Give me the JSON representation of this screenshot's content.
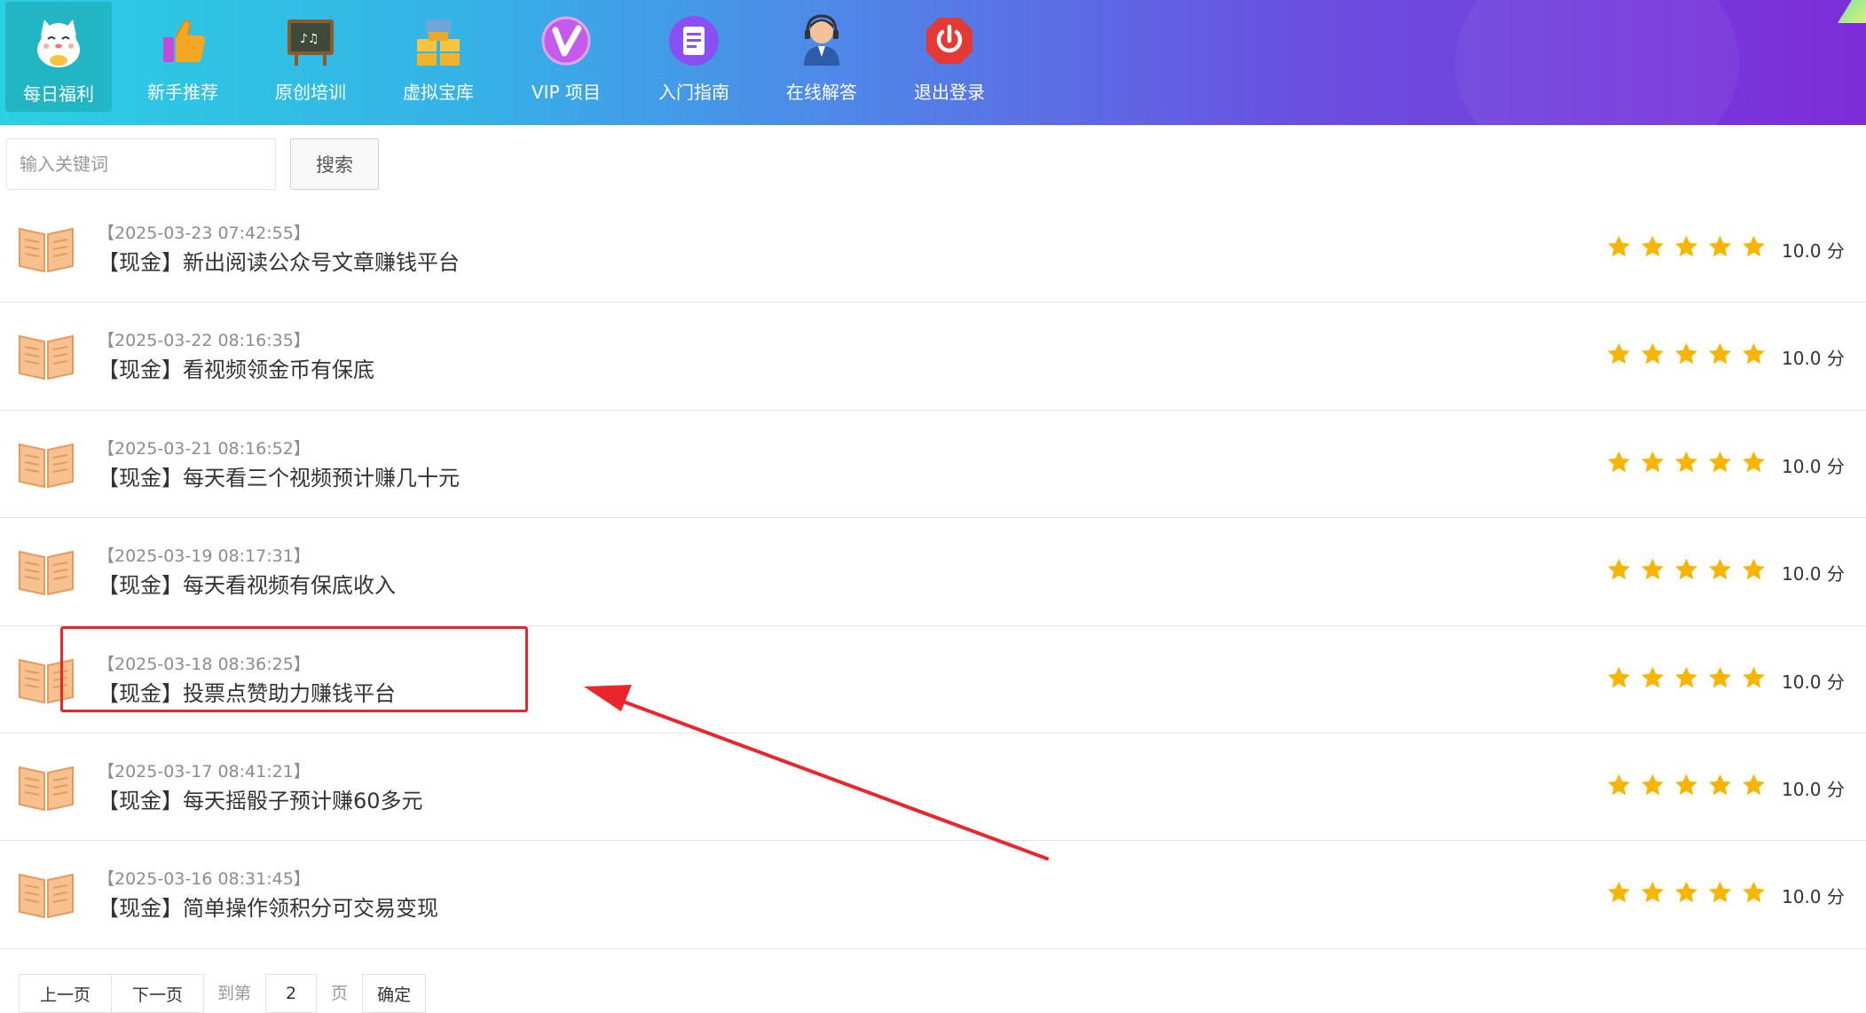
{
  "nav": {
    "items": [
      {
        "label": "每日福利",
        "icon": "lucky-cat-icon",
        "active": true
      },
      {
        "label": "新手推荐",
        "icon": "thumbs-up-icon",
        "active": false
      },
      {
        "label": "原创培训",
        "icon": "blackboard-icon",
        "active": false
      },
      {
        "label": "虚拟宝库",
        "icon": "treasure-boxes-icon",
        "active": false
      },
      {
        "label": "VIP 项目",
        "icon": "vip-badge-icon",
        "active": false
      },
      {
        "label": "入门指南",
        "icon": "document-icon",
        "active": false
      },
      {
        "label": "在线解答",
        "icon": "customer-service-icon",
        "active": false
      },
      {
        "label": "退出登录",
        "icon": "power-icon",
        "active": false
      }
    ]
  },
  "search": {
    "placeholder": "输入关键词",
    "value": "",
    "button_label": "搜索"
  },
  "articles": [
    {
      "date": "【2025-03-23 07:42:55】",
      "title": "【现金】新出阅读公众号文章赚钱平台",
      "rating": 5,
      "score": "10.0 分"
    },
    {
      "date": "【2025-03-22 08:16:35】",
      "title": "【现金】看视频领金币有保底",
      "rating": 5,
      "score": "10.0 分"
    },
    {
      "date": "【2025-03-21 08:16:52】",
      "title": "【现金】每天看三个视频预计赚几十元",
      "rating": 5,
      "score": "10.0 分"
    },
    {
      "date": "【2025-03-19 08:17:31】",
      "title": "【现金】每天看视频有保底收入",
      "rating": 5,
      "score": "10.0 分"
    },
    {
      "date": "【2025-03-18 08:36:25】",
      "title": "【现金】投票点赞助力赚钱平台",
      "rating": 5,
      "score": "10.0 分"
    },
    {
      "date": "【2025-03-17 08:41:21】",
      "title": "【现金】每天摇骰子预计赚60多元",
      "rating": 5,
      "score": "10.0 分"
    },
    {
      "date": "【2025-03-16 08:31:45】",
      "title": "【现金】简单操作领积分可交易变现",
      "rating": 5,
      "score": "10.0 分"
    }
  ],
  "annotation": {
    "highlighted_article_index": 4,
    "color": "#e8262b"
  },
  "pager": {
    "prev_label": "上一页",
    "next_label": "下一页",
    "goto_label": "到第",
    "page_value": "2",
    "page_unit": "页",
    "confirm_label": "确定"
  },
  "colors": {
    "nav_gradient_start": "#2ad0e3",
    "nav_gradient_end": "#7d2cd8",
    "active_tab": "#22b5c4",
    "star": "#f7b500"
  }
}
